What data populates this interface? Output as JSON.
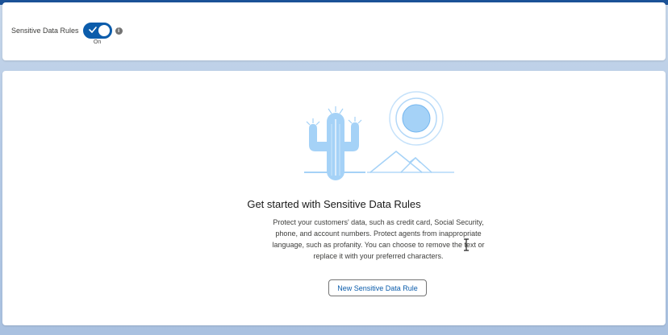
{
  "header": {
    "toggle_label": "Sensitive Data Rules",
    "toggle_state": "On",
    "toggle_checked": true,
    "info_icon": "i"
  },
  "empty_state": {
    "title": "Get started with Sensitive Data Rules",
    "description": "Protect your customers' data, such as credit card, Social Security, phone, and account numbers. Protect agents from inappropriate language, such as profanity. You can choose to remove the text or replace it with your preferred characters.",
    "button_label": "New Sensitive Data Rule"
  },
  "colors": {
    "brand": "#0b5cab",
    "illustration": "#a5d2f7",
    "illustration_stroke": "#74b6ef"
  },
  "icons": {
    "info": "info-icon",
    "check": "check-icon",
    "illustration": "desert-cactus-illustration",
    "cursor": "text-cursor-icon"
  }
}
